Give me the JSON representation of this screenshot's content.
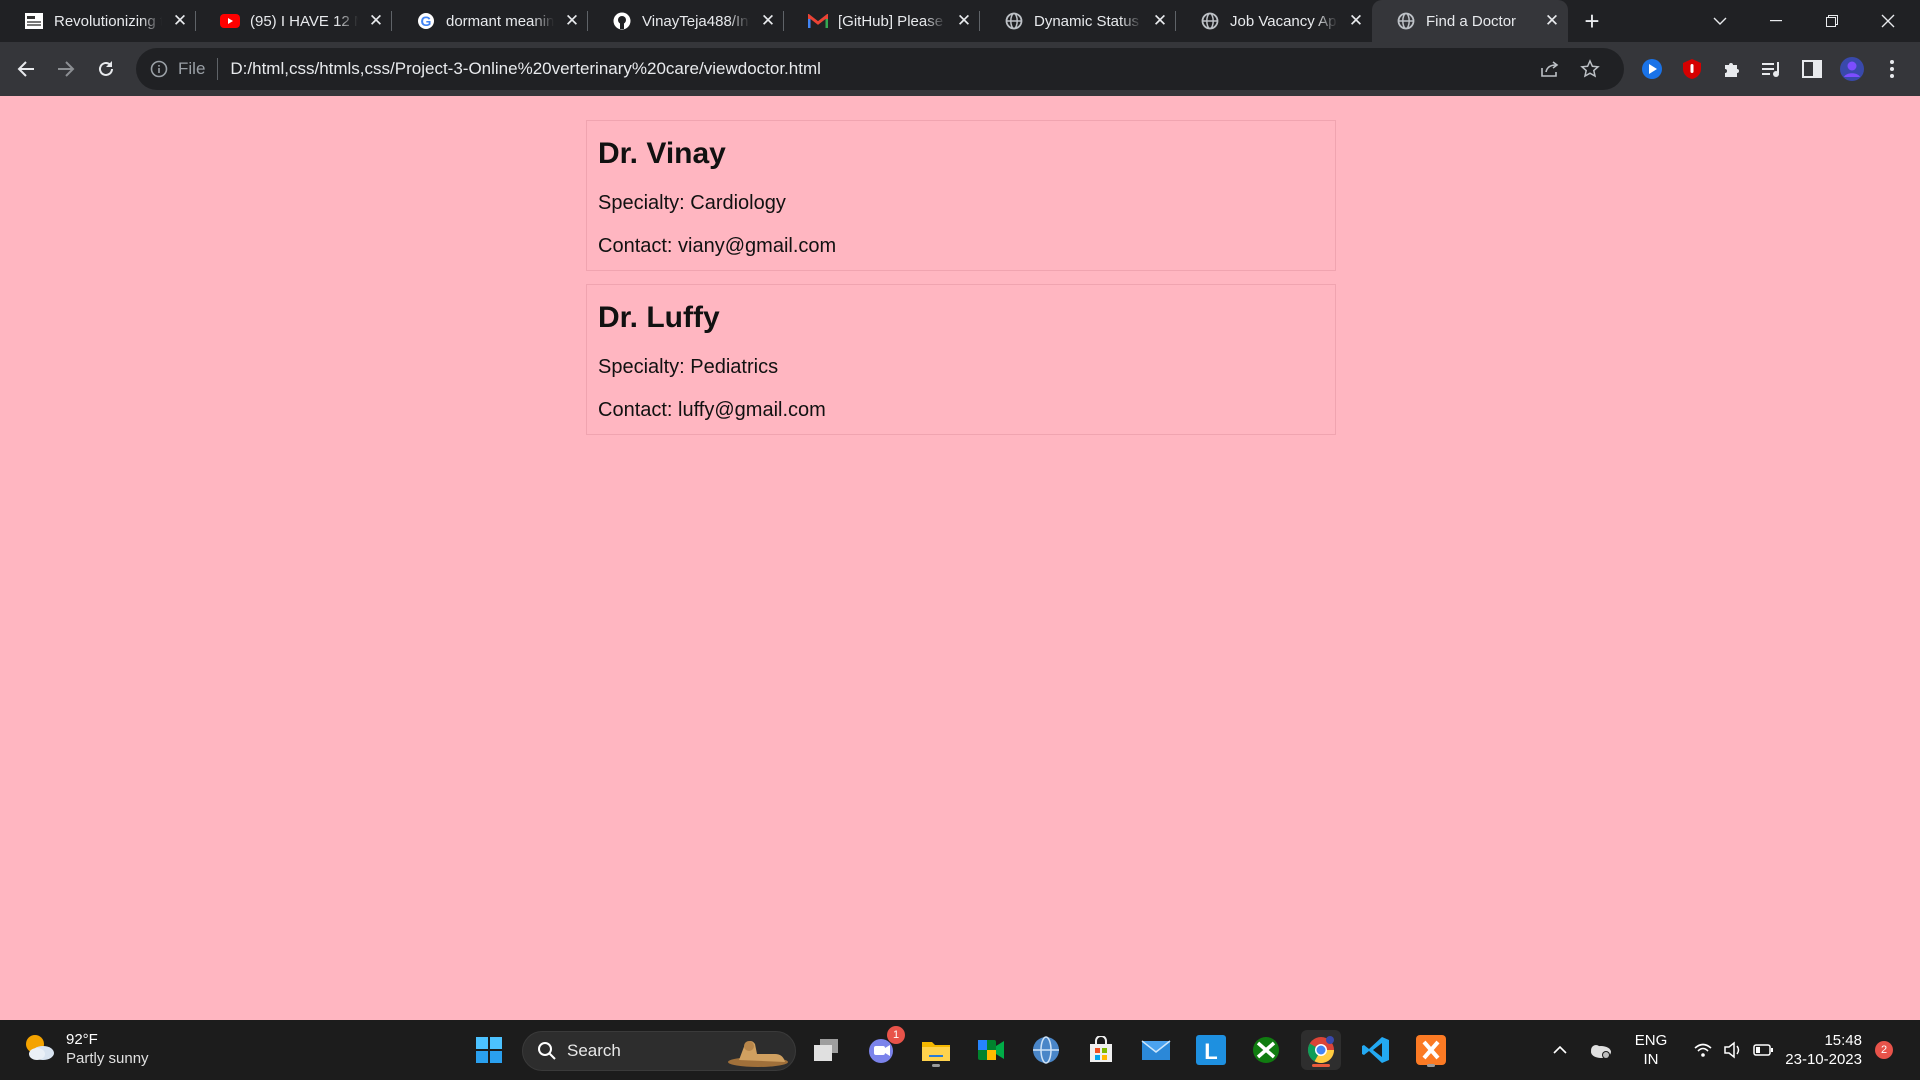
{
  "browser": {
    "tabs": [
      {
        "title": "Revolutionizing t",
        "icon": "news-favicon-icon"
      },
      {
        "title": "(95) I HAVE 12 M",
        "icon": "youtube-icon"
      },
      {
        "title": "dormant meanin",
        "icon": "google-icon"
      },
      {
        "title": "VinayTeja488/Int",
        "icon": "github-icon"
      },
      {
        "title": "[GitHub] Please v",
        "icon": "gmail-icon"
      },
      {
        "title": "Dynamic Status U",
        "icon": "globe-icon"
      },
      {
        "title": "Job Vacancy App",
        "icon": "globe-icon"
      },
      {
        "title": "Find a Doctor",
        "icon": "globe-icon",
        "active": true
      }
    ],
    "address": {
      "scheme_label": "File",
      "url": "D:/html,css/htmls,css/Project-3-Online%20verterinary%20care/viewdoctor.html"
    }
  },
  "page": {
    "doctors": [
      {
        "name": "Dr. Vinay",
        "specialty": "Specialty: Cardiology",
        "contact": "Contact: viany@gmail.com"
      },
      {
        "name": "Dr. Luffy",
        "specialty": "Specialty: Pediatrics",
        "contact": "Contact: luffy@gmail.com"
      }
    ],
    "background_color": "#ffb6c1"
  },
  "taskbar": {
    "weather": {
      "temp": "92°F",
      "condition": "Partly sunny"
    },
    "search_label": "Search",
    "chat_badge": "1",
    "language": {
      "line1": "ENG",
      "line2": "IN"
    },
    "clock": {
      "time": "15:48",
      "date": "23-10-2023"
    },
    "notification_count": "2"
  }
}
